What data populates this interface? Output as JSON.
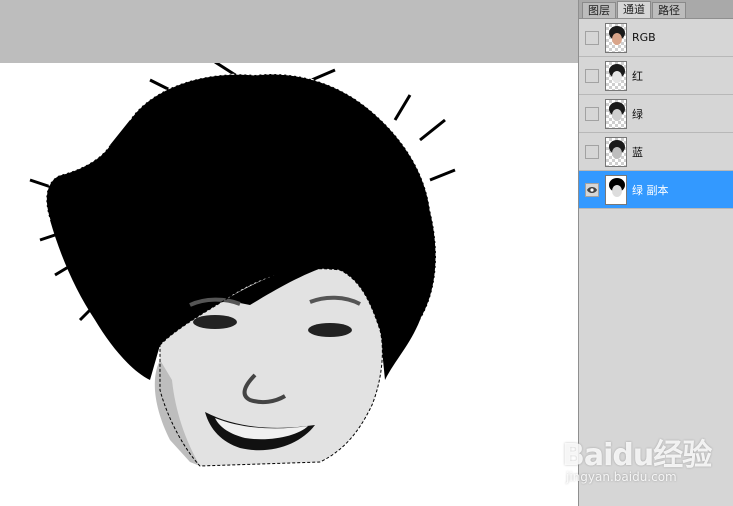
{
  "panel": {
    "tabs": [
      {
        "label": "图层",
        "active": false
      },
      {
        "label": "通道",
        "active": true
      },
      {
        "label": "路径",
        "active": false
      }
    ],
    "channels": [
      {
        "label": "RGB",
        "visible": false,
        "selected": false
      },
      {
        "label": "红",
        "visible": false,
        "selected": false
      },
      {
        "label": "绿",
        "visible": false,
        "selected": false
      },
      {
        "label": "蓝",
        "visible": false,
        "selected": false
      },
      {
        "label": "绿 副本",
        "visible": true,
        "selected": true
      }
    ]
  },
  "watermark": {
    "brand": "Baidu经验",
    "url": "jingyan.baidu.com"
  },
  "colors": {
    "selection_highlight": "#3399ff",
    "panel_bg": "#d6d6d6",
    "workspace_bg": "#bdbdbd"
  }
}
